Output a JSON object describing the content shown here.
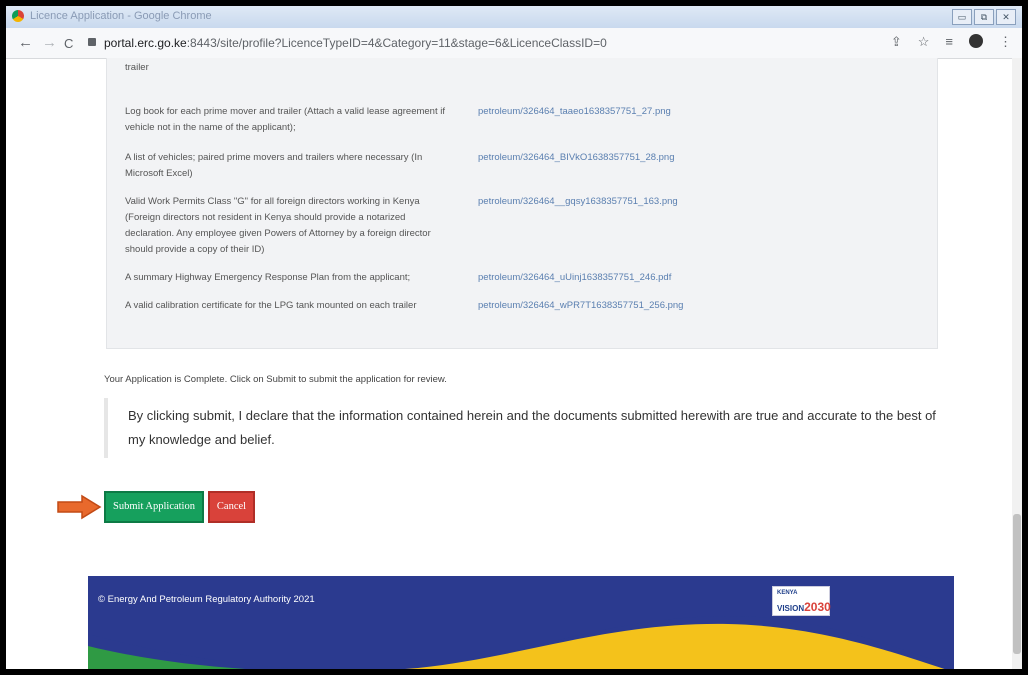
{
  "browser": {
    "title": "Licence Application - Google Chrome",
    "url_host": "portal.erc.go.ke",
    "url_path": ":8443/site/profile?LicenceTypeID=4&Category=11&stage=6&LicenceClassID=0",
    "nav_back": "←",
    "nav_forward": "→",
    "nav_reload": "C",
    "tool_share": "⇪",
    "tool_star": "☆",
    "tool_menu": "⋮"
  },
  "documents": [
    {
      "label": "trailer",
      "link": ""
    },
    {
      "label": "Log book for each prime mover and trailer (Attach a valid lease agreement if vehicle not in the name of the applicant);",
      "link": "petroleum/326464_taaeo1638357751_27.png"
    },
    {
      "label": "A list of vehicles; paired prime movers and trailers where necessary (In Microsoft Excel)",
      "link": "petroleum/326464_BIVkO1638357751_28.png"
    },
    {
      "label": "Valid Work Permits Class \"G\" for all foreign directors working in Kenya (Foreign directors not resident in Kenya should provide a notarized declaration. Any employee given Powers of Attorney by a foreign director should provide a copy of their ID)",
      "link": "petroleum/326464__gqsy1638357751_163.png"
    },
    {
      "label": "A summary Highway Emergency Response Plan from the applicant;",
      "link": "petroleum/326464_uUinj1638357751_246.pdf"
    },
    {
      "label": "A valid calibration certificate for the LPG tank mounted on each trailer",
      "link": "petroleum/326464_wPR7T1638357751_256.png"
    }
  ],
  "complete_message": "Your Application is Complete. Click on Submit to submit the application for review.",
  "declaration": "By clicking submit, I declare that the information contained herein and the documents submitted herewith are true and accurate to the best of my knowledge and belief.",
  "buttons": {
    "submit": "Submit Application",
    "cancel": "Cancel"
  },
  "footer": {
    "copyright": "© Energy And Petroleum Regulatory Authority 2021",
    "logo_kenya": "KENYA",
    "logo_vision": "VISION",
    "logo_year": "2030"
  },
  "colors": {
    "submit": "#16a05d",
    "cancel": "#d9423a",
    "footer_blue": "#2b3a8f",
    "footer_green": "#2f9a44",
    "footer_yellow": "#f4c21b",
    "arrow": "#e8692c"
  }
}
